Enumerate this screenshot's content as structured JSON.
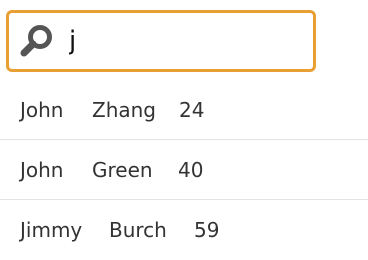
{
  "search": {
    "value": "j",
    "placeholder": ""
  },
  "colors": {
    "focus_border": "#e8a035",
    "text": "#333333",
    "divider": "#e3e3e3"
  },
  "icons": {
    "search": "search-icon"
  },
  "results": [
    {
      "first": "John",
      "last": "Zhang",
      "age": "24"
    },
    {
      "first": "John",
      "last": "Green",
      "age": "40"
    },
    {
      "first": "Jimmy",
      "last": "Burch",
      "age": "59"
    }
  ]
}
